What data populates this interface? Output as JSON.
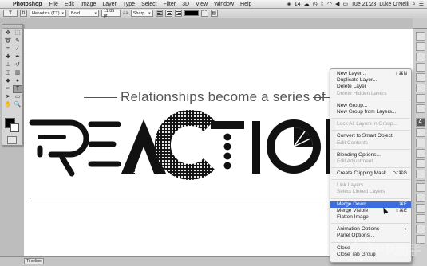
{
  "menubar": {
    "app": "Photoshop",
    "items": [
      "File",
      "Edit",
      "Image",
      "Layer",
      "Type",
      "Select",
      "Filter",
      "3D",
      "View",
      "Window",
      "Help"
    ],
    "notification_count": "14",
    "clock": "Tue 21:23",
    "user": "Luke O'Neill"
  },
  "options_bar": {
    "tool_glyph": "T",
    "font_family": "Helvetica (TT)",
    "font_style": "Bold",
    "font_size": "11.85 pt",
    "aa_label": "aa",
    "antialias": "Sharp",
    "text_color": "#000000"
  },
  "tools": [
    {
      "icon": "move-icon",
      "glyph": "✥"
    },
    {
      "icon": "marquee-icon",
      "glyph": "⬚"
    },
    {
      "icon": "lasso-icon",
      "glyph": "➰"
    },
    {
      "icon": "quick-select-icon",
      "glyph": "✎"
    },
    {
      "icon": "crop-icon",
      "glyph": "⌗"
    },
    {
      "icon": "eyedropper-icon",
      "glyph": "⁄"
    },
    {
      "icon": "heal-icon",
      "glyph": "✚"
    },
    {
      "icon": "brush-icon",
      "glyph": "✒"
    },
    {
      "icon": "stamp-icon",
      "glyph": "⊥"
    },
    {
      "icon": "history-brush-icon",
      "glyph": "↺"
    },
    {
      "icon": "eraser-icon",
      "glyph": "◫"
    },
    {
      "icon": "gradient-icon",
      "glyph": "▥"
    },
    {
      "icon": "blur-icon",
      "glyph": "◆"
    },
    {
      "icon": "dodge-icon",
      "glyph": "●"
    },
    {
      "icon": "pen-icon",
      "glyph": "✑"
    },
    {
      "icon": "type-icon",
      "glyph": "T"
    },
    {
      "icon": "path-select-icon",
      "glyph": "➤"
    },
    {
      "icon": "shape-icon",
      "glyph": "▭"
    },
    {
      "icon": "hand-icon",
      "glyph": "✋"
    },
    {
      "icon": "zoom-icon",
      "glyph": "🔍"
    }
  ],
  "foreground_color": "#000000",
  "background_color": "#ffffff",
  "canvas": {
    "subtitle": "Relationships become a series of",
    "headline": "REACTION"
  },
  "dock": [
    "history-icon",
    "actions-icon",
    "swatches-icon",
    "color-icon",
    "adjustments-icon",
    "styles-icon",
    "brush-panel-icon",
    "clone-source-icon",
    "character-icon",
    "paragraph-icon",
    "character-styles-icon",
    "layers-icon",
    "channels-icon",
    "paths-icon",
    "properties-icon",
    "3d-icon",
    "notes-icon",
    "info-icon",
    "navigator-icon",
    "timeline-icon"
  ],
  "context_menu": [
    {
      "label": "New Layer...",
      "shortcut": "⇧⌘N",
      "disabled": false
    },
    {
      "label": "Duplicate Layer...",
      "shortcut": "",
      "disabled": false
    },
    {
      "label": "Delete Layer",
      "shortcut": "",
      "disabled": false
    },
    {
      "label": "Delete Hidden Layers",
      "shortcut": "",
      "disabled": true
    },
    {
      "sep": true
    },
    {
      "label": "New Group...",
      "shortcut": "",
      "disabled": false
    },
    {
      "label": "New Group from Layers...",
      "shortcut": "",
      "disabled": false
    },
    {
      "sep": true
    },
    {
      "label": "Lock All Layers in Group...",
      "shortcut": "",
      "disabled": true
    },
    {
      "sep": true
    },
    {
      "label": "Convert to Smart Object",
      "shortcut": "",
      "disabled": false
    },
    {
      "label": "Edit Contents",
      "shortcut": "",
      "disabled": true
    },
    {
      "sep": true
    },
    {
      "label": "Blending Options...",
      "shortcut": "",
      "disabled": false
    },
    {
      "label": "Edit Adjustment...",
      "shortcut": "",
      "disabled": true
    },
    {
      "sep": true
    },
    {
      "label": "Create Clipping Mask",
      "shortcut": "⌥⌘G",
      "disabled": false
    },
    {
      "sep": true
    },
    {
      "label": "Link Layers",
      "shortcut": "",
      "disabled": true
    },
    {
      "label": "Select Linked Layers",
      "shortcut": "",
      "disabled": true
    },
    {
      "sep": true
    },
    {
      "label": "Merge Down",
      "shortcut": "⌘E",
      "disabled": false,
      "highlighted": true
    },
    {
      "label": "Merge Visible",
      "shortcut": "⇧⌘E",
      "disabled": false
    },
    {
      "label": "Flatten Image",
      "shortcut": "",
      "disabled": false
    },
    {
      "sep": true
    },
    {
      "label": "Animation Options",
      "shortcut": "",
      "disabled": false,
      "submenu": true
    },
    {
      "label": "Panel Options...",
      "shortcut": "",
      "disabled": false
    },
    {
      "sep": true
    },
    {
      "label": "Close",
      "shortcut": "",
      "disabled": false
    },
    {
      "label": "Close Tab Group",
      "shortcut": "",
      "disabled": false
    }
  ],
  "bottom": {
    "timeline_tab": "Timeline"
  },
  "watermark": "PP助手"
}
